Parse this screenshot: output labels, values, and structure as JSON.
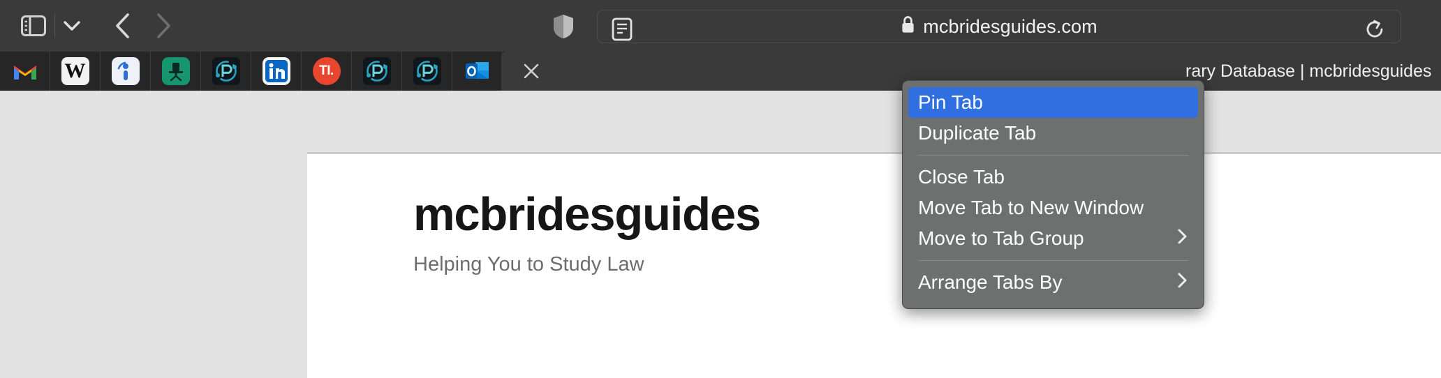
{
  "toolbar": {
    "sidebar_toggle": "sidebar-toggle",
    "sidebar_menu_chevron": "chevron-down",
    "back_label": "Back",
    "forward_label": "Forward",
    "shield_label": "Privacy Report",
    "reader_label": "Reader View",
    "lock_label": "Secure connection",
    "url": "mcbridesguides.com",
    "reload_label": "Reload this page"
  },
  "tabstrip": {
    "pinned_tabs": [
      {
        "name": "gmail",
        "label": "Gmail"
      },
      {
        "name": "westlaw",
        "label": "W"
      },
      {
        "name": "info-app",
        "label": "Info"
      },
      {
        "name": "desk-green",
        "label": "Desk"
      },
      {
        "name": "practice-p-1",
        "label": "P"
      },
      {
        "name": "linkedin",
        "label": "in"
      },
      {
        "name": "ti-red",
        "label": "TI."
      },
      {
        "name": "practice-p-2",
        "label": "P"
      },
      {
        "name": "practice-p-3",
        "label": "P"
      },
      {
        "name": "outlook",
        "label": "Outlook"
      }
    ],
    "active_tab": {
      "title": "rary Database | mcbridesguides",
      "close_label": "×"
    }
  },
  "page": {
    "site_title": "mcbridesguides",
    "tagline": "Helping You to Study Law"
  },
  "context_menu": {
    "items": [
      {
        "label": "Pin Tab",
        "selected": true,
        "submenu": false
      },
      {
        "label": "Duplicate Tab",
        "selected": false,
        "submenu": false
      },
      {
        "label": "Close Tab",
        "selected": false,
        "submenu": false
      },
      {
        "label": "Move Tab to New Window",
        "selected": false,
        "submenu": false
      },
      {
        "label": "Move to Tab Group",
        "selected": false,
        "submenu": true
      },
      {
        "label": "Arrange Tabs By",
        "selected": false,
        "submenu": true
      }
    ],
    "submenu_arrow": "›"
  },
  "colors": {
    "toolbar_bg": "#3a3a3a",
    "tabstrip_bg": "#262626",
    "page_bg": "#e2e2e2",
    "menu_bg": "#6e7070",
    "menu_highlight": "#2f6fdf"
  }
}
